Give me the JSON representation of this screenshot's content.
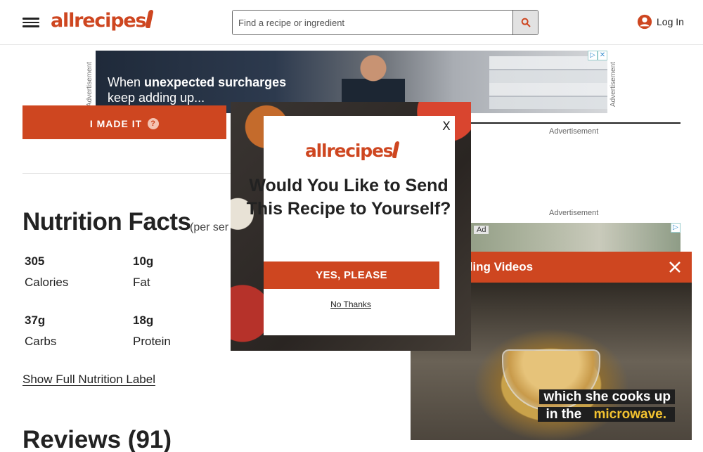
{
  "header": {
    "logo": "allrecipes",
    "search_placeholder": "Find a recipe or ingredient",
    "login_label": "Log In"
  },
  "ads": {
    "label": "Advertisement",
    "top_ad_text_plain": "When",
    "top_ad_text_bold": "unexpected surcharges",
    "top_ad_text_line2": "keep adding up...",
    "right_ad_tag": "Ad"
  },
  "recipe": {
    "made_it_label": "I MADE IT",
    "nutrition_title": "Nutrition Facts",
    "nutrition_subtitle": "(per ser",
    "nutrition": [
      {
        "value": "305",
        "label": "Calories"
      },
      {
        "value": "10g",
        "label": "Fat"
      },
      {
        "value": "37g",
        "label": "Carbs"
      },
      {
        "value": "18g",
        "label": "Protein"
      }
    ],
    "show_full_label": "Show Full Nutrition Label",
    "reviews_title": "Reviews (91)"
  },
  "video": {
    "title": "ding Videos",
    "caption_line1": "which she cooks up",
    "caption_line2_plain": "in the",
    "caption_line2_highlight": "microwave."
  },
  "modal": {
    "logo": "allrecipes",
    "close_label": "X",
    "question": "Would You Like to Send This Recipe to Yourself?",
    "yes_label": "YES, PLEASE",
    "no_label": "No Thanks"
  }
}
